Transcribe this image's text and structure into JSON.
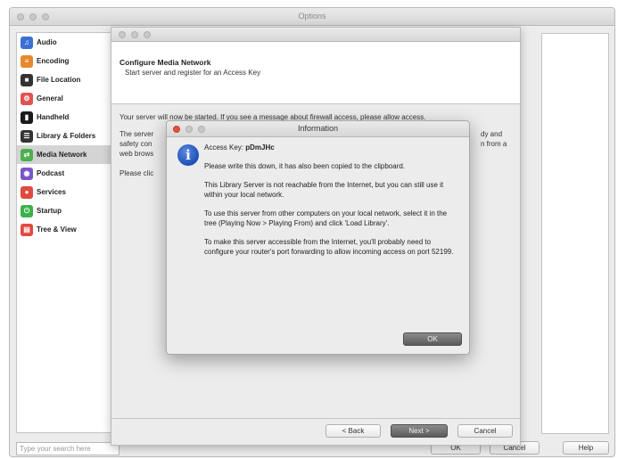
{
  "window": {
    "title": "Options"
  },
  "sidebar": {
    "items": [
      {
        "label": "Audio",
        "icon": "speaker-icon",
        "color": "#3b6fd4",
        "glyph": "♫"
      },
      {
        "label": "Encoding",
        "icon": "encoding-icon",
        "color": "#e8882d",
        "glyph": "≡"
      },
      {
        "label": "File Location",
        "icon": "folder-icon",
        "color": "#333333",
        "glyph": "■"
      },
      {
        "label": "General",
        "icon": "gear-icon",
        "color": "#e05353",
        "glyph": "⚙"
      },
      {
        "label": "Handheld",
        "icon": "handheld-icon",
        "color": "#1a1a1a",
        "glyph": "▮"
      },
      {
        "label": "Library & Folders",
        "icon": "library-icon",
        "color": "#333333",
        "glyph": "☰"
      },
      {
        "label": "Media Network",
        "icon": "network-icon",
        "color": "#4caf50",
        "glyph": "⇄"
      },
      {
        "label": "Podcast",
        "icon": "podcast-icon",
        "color": "#7a55c8",
        "glyph": "◉"
      },
      {
        "label": "Services",
        "icon": "services-icon",
        "color": "#e04a3f",
        "glyph": "●"
      },
      {
        "label": "Startup",
        "icon": "startup-icon",
        "color": "#3cb14a",
        "glyph": "⏻"
      },
      {
        "label": "Tree & View",
        "icon": "tree-icon",
        "color": "#e04a3f",
        "glyph": "▤"
      }
    ],
    "selected": "Media Network"
  },
  "search": {
    "placeholder": "Type your search here"
  },
  "footer": {
    "ok": "OK",
    "cancel": "Cancel",
    "help": "Help"
  },
  "wizard": {
    "title": "Configure Media Network",
    "subtitle": "Start server and register for an Access Key",
    "body1": "Your server will now be started.  If you see a message about firewall access, please allow access.",
    "body2a": "The server",
    "body2b": "safety con",
    "body2c": "web brows",
    "body2_right1": "dy and",
    "body2_right2": "n from a",
    "body3": "Please clic",
    "back": "< Back",
    "next": "Next >",
    "cancel": "Cancel"
  },
  "dialog": {
    "title": "Information",
    "access_key_label": "Access Key: ",
    "access_key_value": "pDmJHc",
    "p1": "Please write this down, it has also been copied to the clipboard.",
    "p2": "This Library Server is not reachable from the Internet, but you can still use it within your local network.",
    "p3": "To use this server from other computers on your local network, select it in the tree (Playing Now > Playing From) and click 'Load Library'.",
    "p4": "To make this server accessible from the Internet, you'll probably need to configure your router's port forwarding to allow incoming access on port 52199.",
    "ok": "OK"
  }
}
